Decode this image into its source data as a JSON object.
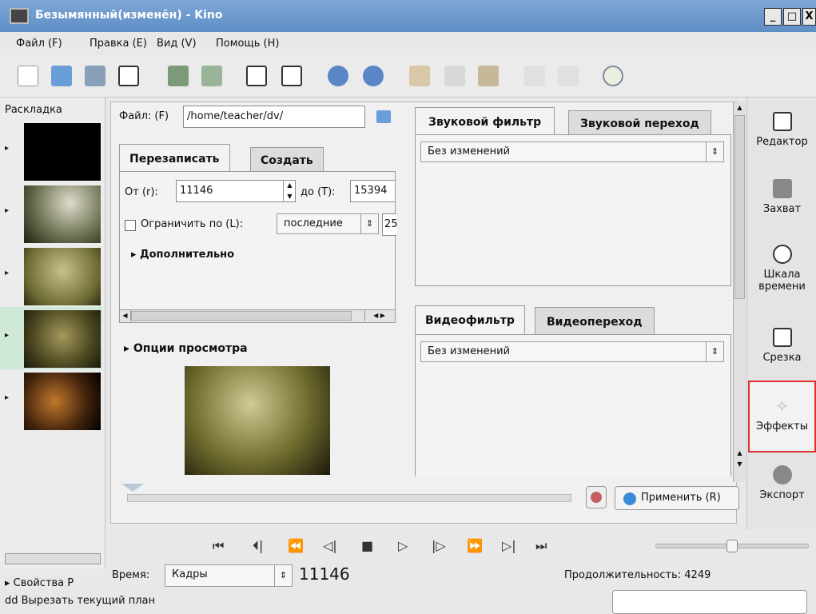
{
  "window": {
    "title": "Безымянный(изменён) - Kino",
    "btn_min": "_",
    "btn_max": "□",
    "btn_close": "X"
  },
  "menu": [
    "Файл (F)",
    "Правка (E)",
    "Вид (V)",
    "Помощь (H)"
  ],
  "storyboard": {
    "label": "Раскладка",
    "properties": "▸ Свойства P"
  },
  "export": {
    "file_label": "Файл: (F)",
    "file_value": "/home/teacher/dv/",
    "tabs": {
      "overwrite": "Перезаписать",
      "create": "Создать"
    },
    "from_label": "От (r):",
    "from_value": "11146",
    "to_label": "до (T):",
    "to_value": "15394",
    "limit_label": "Ограничить по (L):",
    "limit_option": "последние",
    "limit_value": "25",
    "advanced": "▸ Дополнительно",
    "preview": "▸ Опции просмотра"
  },
  "audio": {
    "tab_filter": "Звуковой фильтр",
    "tab_transition": "Звуковой переход",
    "filter_value": "Без изменений"
  },
  "video": {
    "tab_filter": "Видеофильтр",
    "tab_transition": "Видеопереход",
    "filter_value": "Без изменений"
  },
  "apply_button": "Применить (R)",
  "sidebar": {
    "editor": "Редактор",
    "capture": "Захват",
    "timeline": "Шкала времени",
    "trim": "Срезка",
    "effects": "Эффекты",
    "export": "Экспорт"
  },
  "transport": [
    "⏮",
    "⏴|",
    "⏪",
    "◁|",
    "■",
    "▷",
    "|▷",
    "⏩",
    "▷|",
    "⏭"
  ],
  "status": {
    "time_label": "Время:",
    "time_mode": "Кадры",
    "frame": "11146",
    "duration": "Продолжительность: 4249",
    "message": "dd  Вырезать текущий план"
  },
  "colors": {
    "title_bar": "#5f8ec6",
    "selection": "#cfe8d8",
    "highlight_border": "#e03030"
  }
}
